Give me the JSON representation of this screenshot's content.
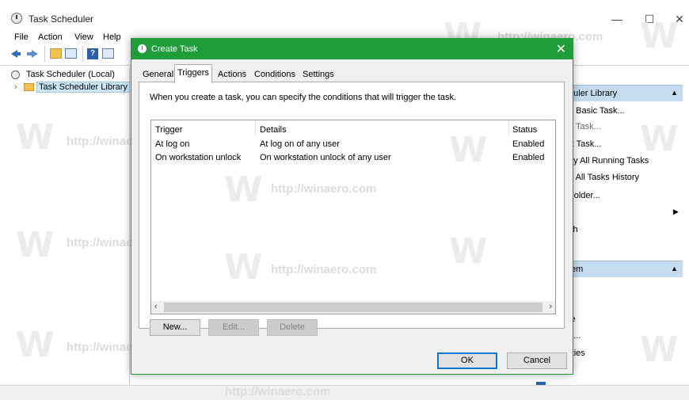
{
  "window": {
    "title": "Task Scheduler",
    "minimize": "—",
    "maximize": "☐",
    "close": "✕"
  },
  "menu": [
    "File",
    "Action",
    "View",
    "Help"
  ],
  "tree": {
    "root": "Task Scheduler (Local)",
    "library": "Task Scheduler Library",
    "expander": "›"
  },
  "actions_pane": {
    "section1_header": "duler Library",
    "section1_items": [
      "e Basic Task...",
      "e Task...",
      "rt Task...",
      "ay All Running Tasks",
      "e All Tasks History",
      "Folder...",
      "",
      "sh"
    ],
    "section2_header": "tem",
    "section2_items": [
      "le",
      "n...",
      "rties"
    ],
    "collapse_arrow": "▲",
    "submenu_arrow": "▶"
  },
  "watermark": {
    "letter": "W",
    "text": "http://winaero.com"
  },
  "dialog": {
    "title": "Create Task",
    "close": "✕",
    "tabs": [
      "General",
      "Triggers",
      "Actions",
      "Conditions",
      "Settings"
    ],
    "active_tab": "Triggers",
    "intro": "When you create a task, you can specify the conditions that will trigger the task.",
    "columns": [
      "Trigger",
      "Details",
      "Status"
    ],
    "rows": [
      {
        "trigger": "At log on",
        "details": "At log on of any user",
        "status": "Enabled"
      },
      {
        "trigger": "On workstation unlock",
        "details": "On workstation unlock of any user",
        "status": "Enabled"
      }
    ],
    "scroll_left": "‹",
    "scroll_right": "›",
    "buttons": {
      "new": "New...",
      "edit": "Edit...",
      "delete": "Delete",
      "ok": "OK",
      "cancel": "Cancel"
    }
  }
}
